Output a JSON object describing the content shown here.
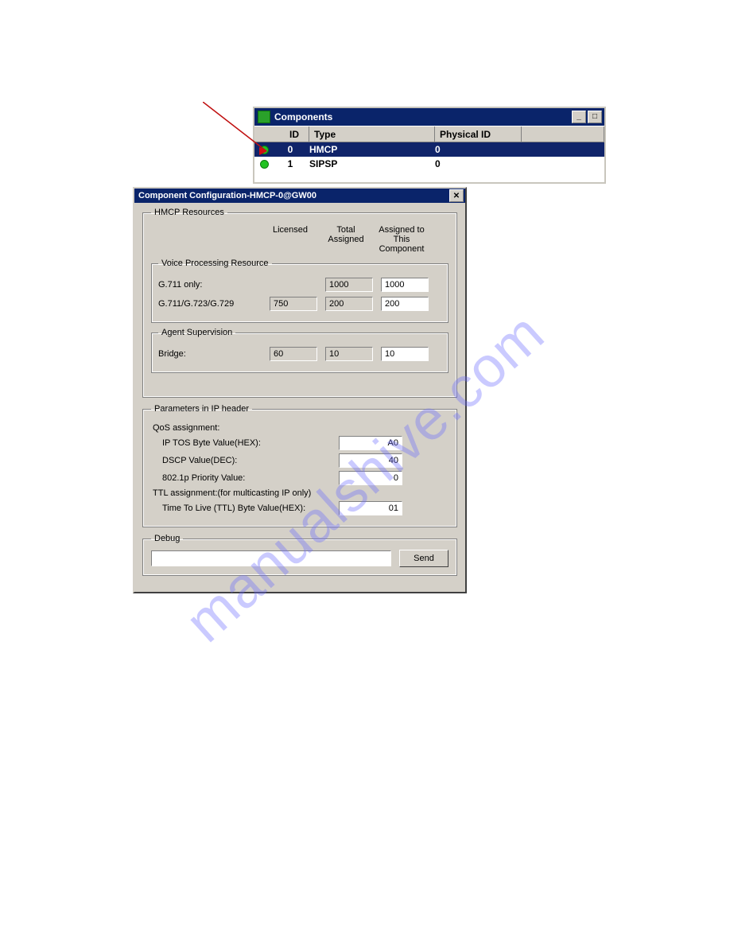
{
  "watermark": "manualshive.com",
  "components_window": {
    "title": "Components",
    "headers": {
      "id": "ID",
      "type": "Type",
      "phys": "Physical ID"
    },
    "rows": [
      {
        "id": "0",
        "type": "HMCP",
        "phys": "0",
        "selected": true
      },
      {
        "id": "1",
        "type": "SIPSP",
        "phys": "0",
        "selected": false
      }
    ],
    "winbuttons": {
      "minimize": "_",
      "maximize": "□"
    }
  },
  "config_dialog": {
    "title": "Component Configuration-HMCP-0@GW00",
    "close": "✕",
    "groups": {
      "hmcp": {
        "legend": "HMCP Resources",
        "col_headers": {
          "licensed": "Licensed",
          "total": "Total\nAssigned",
          "assigned": "Assigned to\nThis\nComponent"
        },
        "voice": {
          "legend": "Voice Processing Resource",
          "rows": [
            {
              "label": "G.711 only:",
              "licensed": "",
              "total": "1000",
              "assigned": "1000"
            },
            {
              "label": "G.711/G.723/G.729",
              "licensed": "750",
              "total": "200",
              "assigned": "200"
            }
          ]
        },
        "agent": {
          "legend": "Agent Supervision",
          "rows": [
            {
              "label": "Bridge:",
              "licensed": "60",
              "total": "10",
              "assigned": "10"
            }
          ]
        }
      },
      "params": {
        "legend": "Parameters in IP header",
        "qos_label": "QoS assignment:",
        "qos_rows": [
          {
            "label": "IP TOS Byte Value(HEX):",
            "value": "A0"
          },
          {
            "label": "DSCP Value(DEC):",
            "value": "40"
          },
          {
            "label": "802.1p Priority Value:",
            "value": "0"
          }
        ],
        "ttl_label": "TTL assignment:(for multicasting IP only)",
        "ttl_row": {
          "label": "Time To Live (TTL) Byte Value(HEX):",
          "value": "01"
        }
      },
      "debug": {
        "legend": "Debug",
        "value": "",
        "send": "Send"
      }
    }
  }
}
